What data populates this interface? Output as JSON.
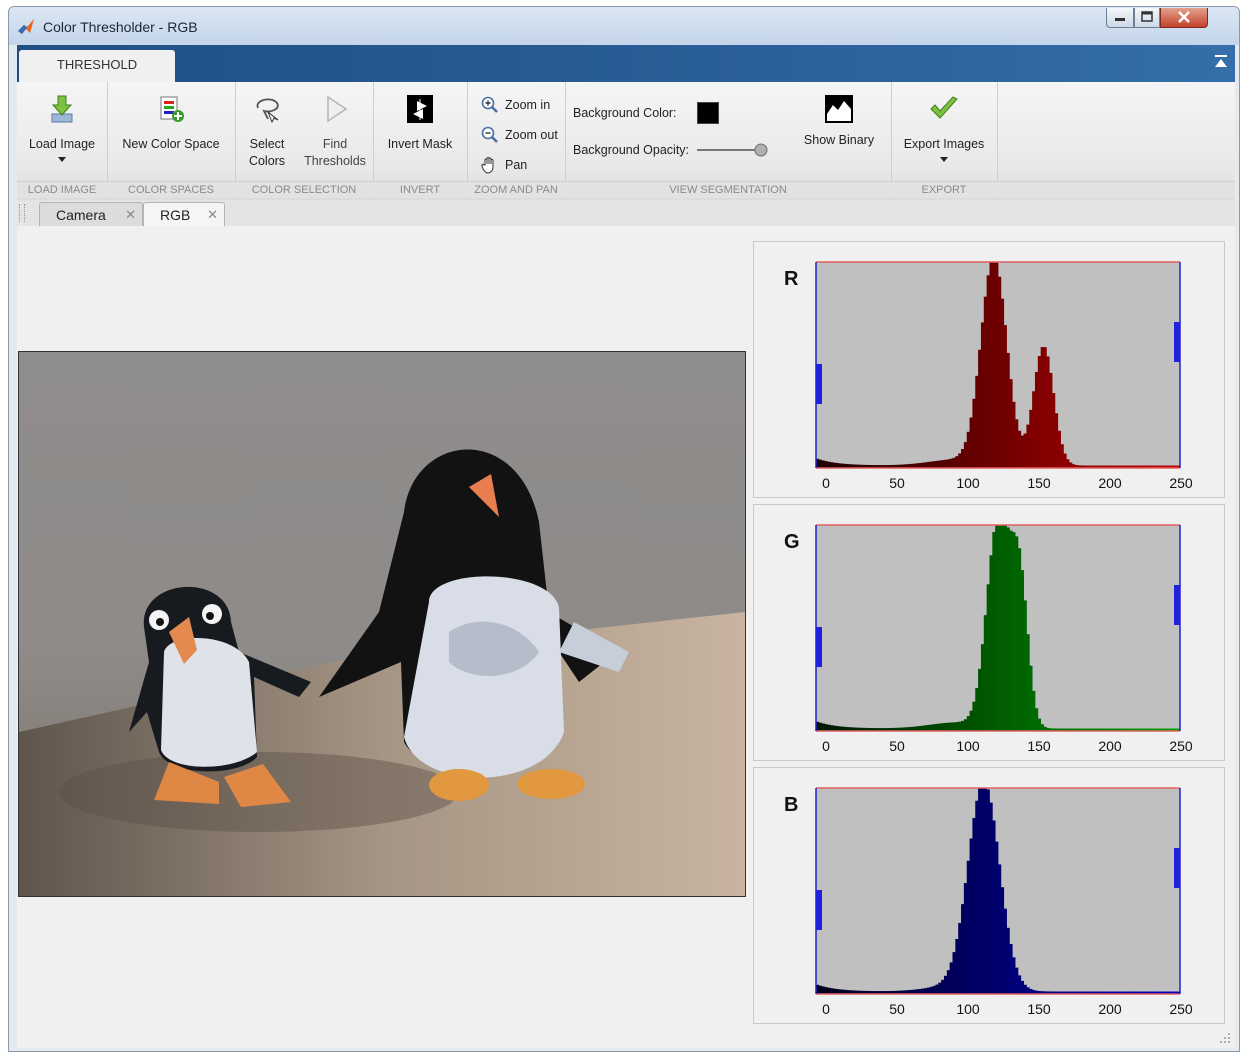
{
  "window": {
    "title": "Color Thresholder - RGB"
  },
  "ribbon": {
    "tab_label": "THRESHOLD",
    "sections": {
      "load_image": {
        "label": "LOAD IMAGE",
        "button": "Load Image"
      },
      "color_spaces": {
        "label": "COLOR SPACES",
        "button": "New Color Space"
      },
      "color_selection": {
        "label": "COLOR SELECTION",
        "select_line1": "Select",
        "select_line2": "Colors",
        "find_line1": "Find",
        "find_line2": "Thresholds"
      },
      "invert": {
        "label": "INVERT",
        "button": "Invert Mask"
      },
      "zoom_pan": {
        "label": "ZOOM AND PAN",
        "zoom_in": "Zoom in",
        "zoom_out": "Zoom out",
        "pan": "Pan"
      },
      "view_segmentation": {
        "label": "VIEW SEGMENTATION",
        "background_color_label": "Background Color:",
        "background_color": "#000000",
        "background_opacity_label": "Background Opacity:",
        "background_opacity": 1.0,
        "show_binary": "Show Binary"
      },
      "export": {
        "label": "EXPORT",
        "button": "Export Images"
      }
    }
  },
  "doc_tabs": [
    {
      "label": "Camera",
      "close": "✕"
    },
    {
      "label": "RGB",
      "close": "✕"
    }
  ],
  "histograms": {
    "tick_labels": [
      "0",
      "50",
      "100",
      "150",
      "200",
      "250"
    ],
    "channels": [
      {
        "letter": "R",
        "color": "#c00000",
        "low_handle": 0,
        "high_handle": 255,
        "peaks": [
          {
            "center": 125,
            "height": 1.0,
            "width": 9
          },
          {
            "center": 160,
            "height": 0.58,
            "width": 7
          }
        ]
      },
      {
        "letter": "G",
        "color": "#00a000",
        "low_handle": 0,
        "high_handle": 255,
        "peaks": [
          {
            "center": 128,
            "height": 1.0,
            "width": 8
          },
          {
            "center": 143,
            "height": 0.7,
            "width": 6
          }
        ]
      },
      {
        "letter": "B",
        "color": "#0000c0",
        "low_handle": 0,
        "high_handle": 255,
        "peaks": [
          {
            "center": 118,
            "height": 1.0,
            "width": 11
          }
        ]
      }
    ]
  }
}
